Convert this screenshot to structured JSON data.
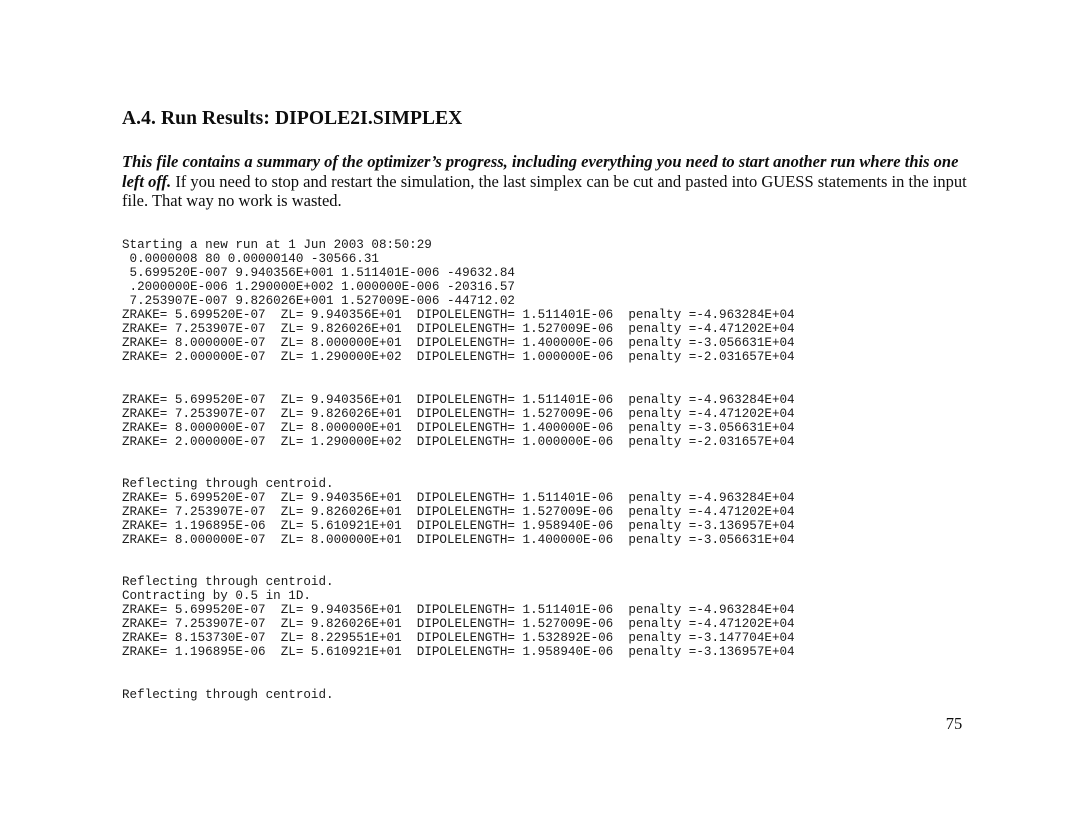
{
  "document": {
    "heading": "A.4. Run Results: DIPOLE2I.SIMPLEX",
    "intro": {
      "lead": "This file contains a summary of the optimizer’s progress, including everything you need to start another run where this one left off.",
      "rest": "  If you need to stop and restart the simulation, the last simplex can be cut and pasted into GUESS statements in the input file.  That way no work is wasted."
    },
    "page_number": "75",
    "listing": "Starting a new run at 1 Jun 2003 08:50:29\n 0.0000008 80 0.00000140 -30566.31\n 5.699520E-007 9.940356E+001 1.511401E-006 -49632.84\n .2000000E-006 1.290000E+002 1.000000E-006 -20316.57\n 7.253907E-007 9.826026E+001 1.527009E-006 -44712.02\nZRAKE= 5.699520E-07  ZL= 9.940356E+01  DIPOLELENGTH= 1.511401E-06  penalty =-4.963284E+04\nZRAKE= 7.253907E-07  ZL= 9.826026E+01  DIPOLELENGTH= 1.527009E-06  penalty =-4.471202E+04\nZRAKE= 8.000000E-07  ZL= 8.000000E+01  DIPOLELENGTH= 1.400000E-06  penalty =-3.056631E+04\nZRAKE= 2.000000E-07  ZL= 1.290000E+02  DIPOLELENGTH= 1.000000E-06  penalty =-2.031657E+04\n\n\nZRAKE= 5.699520E-07  ZL= 9.940356E+01  DIPOLELENGTH= 1.511401E-06  penalty =-4.963284E+04\nZRAKE= 7.253907E-07  ZL= 9.826026E+01  DIPOLELENGTH= 1.527009E-06  penalty =-4.471202E+04\nZRAKE= 8.000000E-07  ZL= 8.000000E+01  DIPOLELENGTH= 1.400000E-06  penalty =-3.056631E+04\nZRAKE= 2.000000E-07  ZL= 1.290000E+02  DIPOLELENGTH= 1.000000E-06  penalty =-2.031657E+04\n\n\nReflecting through centroid.\nZRAKE= 5.699520E-07  ZL= 9.940356E+01  DIPOLELENGTH= 1.511401E-06  penalty =-4.963284E+04\nZRAKE= 7.253907E-07  ZL= 9.826026E+01  DIPOLELENGTH= 1.527009E-06  penalty =-4.471202E+04\nZRAKE= 1.196895E-06  ZL= 5.610921E+01  DIPOLELENGTH= 1.958940E-06  penalty =-3.136957E+04\nZRAKE= 8.000000E-07  ZL= 8.000000E+01  DIPOLELENGTH= 1.400000E-06  penalty =-3.056631E+04\n\n\nReflecting through centroid.\nContracting by 0.5 in 1D.\nZRAKE= 5.699520E-07  ZL= 9.940356E+01  DIPOLELENGTH= 1.511401E-06  penalty =-4.963284E+04\nZRAKE= 7.253907E-07  ZL= 9.826026E+01  DIPOLELENGTH= 1.527009E-06  penalty =-4.471202E+04\nZRAKE= 8.153730E-07  ZL= 8.229551E+01  DIPOLELENGTH= 1.532892E-06  penalty =-3.147704E+04\nZRAKE= 1.196895E-06  ZL= 5.610921E+01  DIPOLELENGTH= 1.958940E-06  penalty =-3.136957E+04\n\n\nReflecting through centroid."
  }
}
